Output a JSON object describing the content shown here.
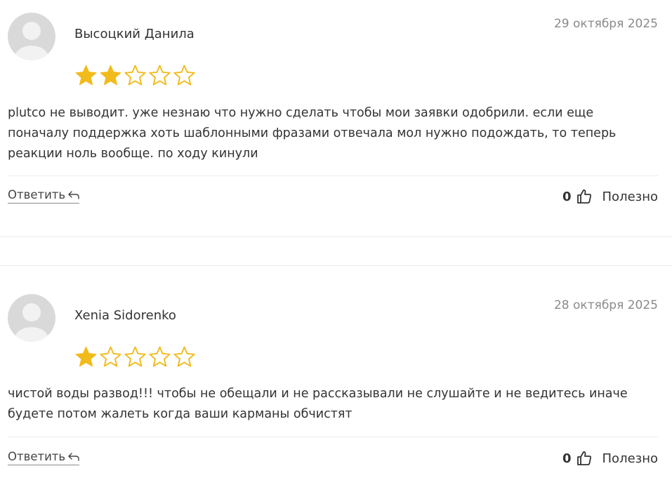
{
  "reviews": [
    {
      "author": "Высоцкий Данила",
      "date": "29 октября 2025",
      "rating": 2,
      "rating_max": 5,
      "text": "plutco не выводит. уже незнаю что нужно сделать чтобы мои заявки одобрили. если еще поначалу поддержка хоть шаблонными фразами отвечала мол нужно подождать, то теперь реакции ноль вообще. по ходу кинули",
      "reply_label": "Ответить",
      "helpful_count": "0",
      "helpful_label": "Полезно"
    },
    {
      "author": "Xenia Sidorenko",
      "date": "28 октября 2025",
      "rating": 1,
      "rating_max": 5,
      "text": "чистой воды развод!!! чтобы не обещали и не рассказывали не слушайте и не ведитесь иначе будете потом жалеть когда ваши карманы обчистят",
      "reply_label": "Ответить",
      "helpful_count": "0",
      "helpful_label": "Полезно"
    }
  ],
  "colors": {
    "star": "#f2bb1c",
    "avatar_bg": "#d9d9d9",
    "avatar_fg": "#f2f2f2",
    "text": "#333333",
    "date": "#8a8a8a",
    "divider": "#ececec"
  },
  "icons": {
    "avatar": "avatar-placeholder-icon",
    "star_filled": "star-filled-icon",
    "star_empty": "star-outline-icon",
    "reply": "reply-arrow-icon",
    "like": "thumbs-up-icon"
  }
}
